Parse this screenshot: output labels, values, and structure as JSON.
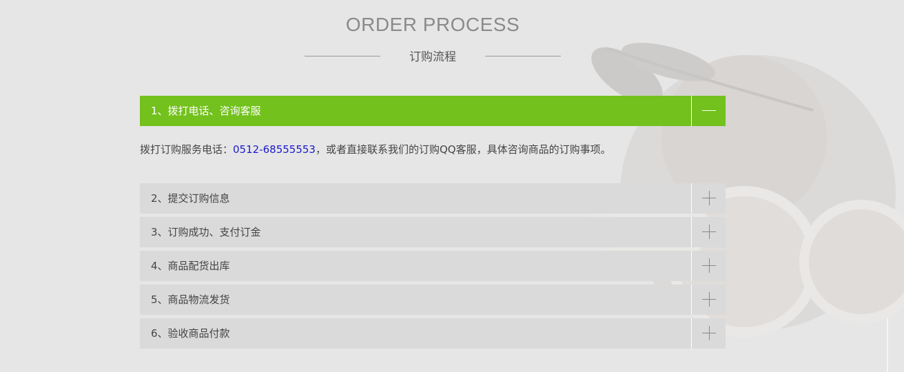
{
  "header": {
    "title_en": "ORDER PROCESS",
    "title_cn": "订购流程"
  },
  "accordion": {
    "items": [
      {
        "label": "1、拨打电话、咨询客服",
        "expanded": true,
        "toggle_icon": "minus-icon"
      },
      {
        "label": "2、提交订购信息",
        "expanded": false,
        "toggle_icon": "plus-icon"
      },
      {
        "label": "3、订购成功、支付订金",
        "expanded": false,
        "toggle_icon": "plus-icon"
      },
      {
        "label": "4、商品配货出库",
        "expanded": false,
        "toggle_icon": "plus-icon"
      },
      {
        "label": "5、商品物流发货",
        "expanded": false,
        "toggle_icon": "plus-icon"
      },
      {
        "label": "6、验收商品付款",
        "expanded": false,
        "toggle_icon": "plus-icon"
      }
    ],
    "expanded_body": {
      "prefix": "拨打订购服务电话：",
      "phone": "0512-68555553",
      "suffix": "，或者直接联系我们的订购QQ客服，具体咨询商品的订购事项。"
    }
  },
  "colors": {
    "background": "#e7e6e6",
    "accent": "#73c11d",
    "item_background": "#dadada",
    "phone_link": "#1a1acc"
  }
}
